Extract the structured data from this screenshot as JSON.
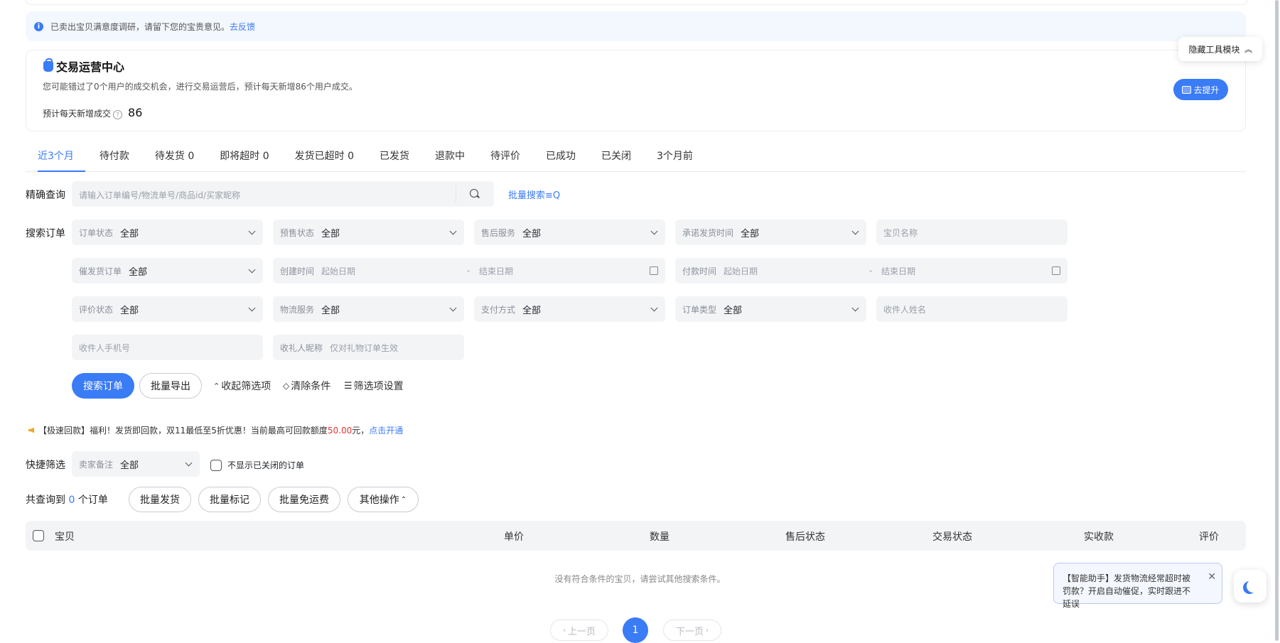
{
  "notice": {
    "text": "已卖出宝贝满意度调研，请留下您的宝贵意见。",
    "link": "去反馈"
  },
  "hide_tools": {
    "label": "隐藏工具模块"
  },
  "ops_card": {
    "title": "交易运营中心",
    "desc": "您可能错过了0个用户的成交机会，进行交易运营后，预计每天新增86个用户成交。",
    "stat_label": "预计每天新增成交",
    "stat_value": "86",
    "button": "去提升"
  },
  "tabs": [
    {
      "label": "近3个月"
    },
    {
      "label": "待付款"
    },
    {
      "label": "待发货 0"
    },
    {
      "label": "即将超时 0"
    },
    {
      "label": "发货已超时 0"
    },
    {
      "label": "已发货"
    },
    {
      "label": "退款中"
    },
    {
      "label": "待评价"
    },
    {
      "label": "已成功"
    },
    {
      "label": "已关闭"
    },
    {
      "label": "3个月前"
    }
  ],
  "precise": {
    "label": "精确查询",
    "placeholder": "请输入订单编号/物流单号/商品id/买家昵称",
    "batch_link": "批量搜索",
    "batch_icon": "≡Q"
  },
  "search": {
    "label": "搜索订单",
    "order_status": {
      "label": "订单状态",
      "value": "全部"
    },
    "presale_status": {
      "label": "预售状态",
      "value": "全部"
    },
    "aftersale": {
      "label": "售后服务",
      "value": "全部"
    },
    "promise_time": {
      "label": "承诺发货时间",
      "value": "全部"
    },
    "item_name": {
      "placeholder": "宝贝名称"
    },
    "urge_order": {
      "label": "催发货订单",
      "value": "全部"
    },
    "create_time": {
      "label": "创建时间",
      "start": "起始日期",
      "sep": "-",
      "end": "结束日期"
    },
    "pay_time": {
      "label": "付款时间",
      "start": "起始日期",
      "sep": "-",
      "end": "结束日期"
    },
    "review_status": {
      "label": "评价状态",
      "value": "全部"
    },
    "logistics": {
      "label": "物流服务",
      "value": "全部"
    },
    "pay_method": {
      "label": "支付方式",
      "value": "全部"
    },
    "order_type": {
      "label": "订单类型",
      "value": "全部"
    },
    "receiver_name": {
      "placeholder": "收件人姓名"
    },
    "receiver_phone": {
      "placeholder": "收件人手机号"
    },
    "gift_nick": {
      "label": "收礼人昵称",
      "placeholder": "仅对礼物订单生效"
    }
  },
  "actions": {
    "search": "搜索订单",
    "export": "批量导出",
    "collapse": "收起筛选项",
    "clear": "清除条件",
    "settings": "筛选项设置"
  },
  "promo": {
    "text1": "【极速回款】福利！发货即回款，双11最低至5折优惠！当前最高可回款额度",
    "amount": "50.00",
    "text2": "元，",
    "link": "点击开通"
  },
  "quick": {
    "label": "快捷筛选",
    "seller_note": {
      "label": "卖家备注",
      "value": "全部"
    },
    "hide_closed": "不显示已关闭的订单"
  },
  "result": {
    "prefix": "共查询到",
    "count": "0",
    "suffix": "个订单",
    "buttons": {
      "batch_ship": "批量发货",
      "batch_mark": "批量标记",
      "batch_free": "批量免运费",
      "other": "其他操作"
    }
  },
  "table": {
    "columns": [
      "宝贝",
      "单价",
      "数量",
      "售后状态",
      "交易状态",
      "实收款",
      "评价"
    ],
    "empty": "没有符合条件的宝贝，请尝试其他搜索条件。"
  },
  "pagination": {
    "prev": "上一页",
    "current": "1",
    "next": "下一页"
  },
  "assistant": {
    "text": "【智能助手】发货物流经常超时被罚款？开启自动催促，实时跟进不延误"
  },
  "colors": {
    "accent": "#3a7bf6",
    "promo_amount": "#e33333"
  }
}
